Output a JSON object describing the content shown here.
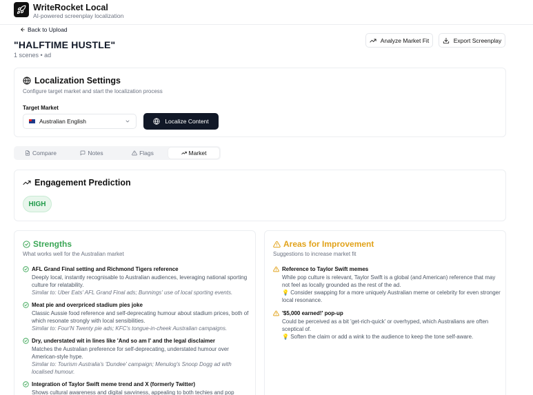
{
  "app": {
    "title": "WriteRocket Local",
    "subtitle": "AI-powered screenplay localization"
  },
  "nav": {
    "back_label": "Back to Upload"
  },
  "document": {
    "title": "\"HALFTIME HUSTLE\"",
    "meta": "1 scenes • ad"
  },
  "actions": {
    "analyze_label": "Analyze Market Fit",
    "export_label": "Export Screenplay"
  },
  "settings": {
    "title": "Localization Settings",
    "subtitle": "Configure target market and start the localization process",
    "market_label": "Target Market",
    "market_value": "Australian English",
    "localize_label": "Localize Content"
  },
  "tabs": [
    {
      "label": "Compare",
      "icon": "document-icon",
      "active": false
    },
    {
      "label": "Notes",
      "icon": "chat-icon",
      "active": false
    },
    {
      "label": "Flags",
      "icon": "warning-icon",
      "active": false
    },
    {
      "label": "Market",
      "icon": "trending-up-icon",
      "active": true
    }
  ],
  "engagement": {
    "title": "Engagement Prediction",
    "level": "HIGH"
  },
  "strengths": {
    "title": "Strengths",
    "subtitle": "What works well for the Australian market",
    "items": [
      {
        "title": "AFL Grand Final setting and Richmond Tigers reference",
        "body": "Deeply local, instantly recognisable to Australian audiences, leveraging national sporting culture for relatability.",
        "similar": "Similar to: Uber Eats' AFL Grand Final ads; Bunnings' use of local sporting events."
      },
      {
        "title": "Meat pie and overpriced stadium pies joke",
        "body": "Classic Aussie food reference and self-deprecating humour about stadium prices, both of which resonate strongly with local sensibilities.",
        "similar": "Similar to: Four'N Twenty pie ads; KFC's tongue-in-cheek Australian campaigns."
      },
      {
        "title": "Dry, understated wit in lines like 'And so am I' and the legal disclaimer",
        "body": "Matches the Australian preference for self-deprecating, understated humour over American-style hype.",
        "similar": "Similar to: Tourism Australia's 'Dundee' campaign; Menulog's Snoop Dogg ad with localised humour."
      },
      {
        "title": "Integration of Taylor Swift meme trend and X (formerly Twitter)",
        "body": "Shows cultural awareness and digital savviness, appealing to both techies and pop culture",
        "similar": ""
      }
    ]
  },
  "improvements": {
    "title": "Areas for Improvement",
    "subtitle": "Suggestions to increase market fit",
    "items": [
      {
        "title": "Reference to Taylor Swift memes",
        "body": "While pop culture is relevant, Taylor Swift is a global (and American) reference that may not feel as locally grounded as the rest of the ad.",
        "tip": "Consider swapping for a more uniquely Australian meme or celebrity for even stronger local resonance."
      },
      {
        "title": "'$5,000 earned!' pop-up",
        "body": "Could be perceived as a bit 'get-rich-quick' or overhyped, which Australians are often sceptical of.",
        "tip": "Soften the claim or add a wink to the audience to keep the tone self-aware."
      }
    ]
  },
  "colors": {
    "strength": "#3aa655",
    "improve": "#e1a21a",
    "primary": "#111827"
  }
}
